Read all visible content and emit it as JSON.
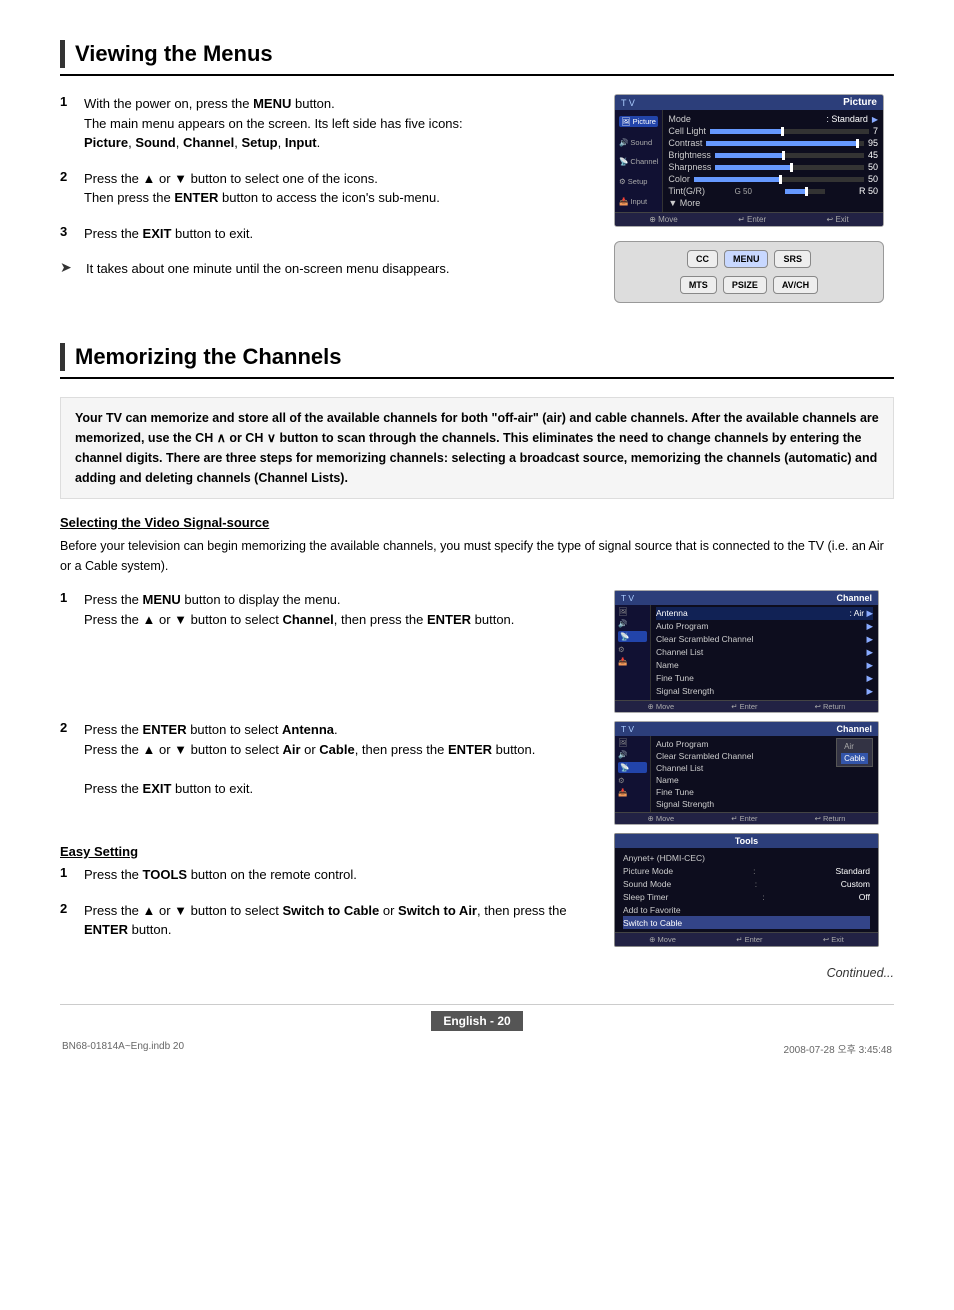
{
  "page": {
    "title": "Viewing the Menus",
    "section2_title": "Memorizing the Channels",
    "footer_text": "English - 20",
    "bottom_left": "BN68-01814A~Eng.indb   20",
    "bottom_right": "2008-07-28   오후 3:45:48",
    "continued": "Continued..."
  },
  "section1": {
    "steps": [
      {
        "num": "1",
        "text": "With the power on, press the MENU button.\nThe main menu appears on the screen. Its left side has five icons:\nPicture, Sound, Channel, Setup, Input."
      },
      {
        "num": "2",
        "text": "Press the ▲ or ▼ button to select one of the icons.\nThen press the ENTER button to access the icon's sub-menu."
      },
      {
        "num": "3",
        "text": "Press the EXIT button to exit."
      }
    ],
    "tip": "It takes about one minute until the on-screen menu disappears.",
    "tv_ui": {
      "header_tv": "T V",
      "header_section": "Picture",
      "sidebar_items": [
        "Picture",
        "Sound",
        "Channel",
        "Setup",
        "Input"
      ],
      "active_sidebar": "Picture",
      "rows": [
        {
          "label": "Mode",
          "value": ": Standard",
          "has_bar": false,
          "has_arrow": true
        },
        {
          "label": "Cell Light",
          "value": "7",
          "has_bar": true,
          "bar_pct": 45,
          "tick": 45
        },
        {
          "label": "Contrast",
          "value": "95",
          "has_bar": true,
          "bar_pct": 95,
          "tick": 95
        },
        {
          "label": "Brightness",
          "value": "45",
          "has_bar": true,
          "bar_pct": 45,
          "tick": 45
        },
        {
          "label": "Sharpness",
          "value": "50",
          "has_bar": true,
          "bar_pct": 50,
          "tick": 50
        },
        {
          "label": "Color",
          "value": "50",
          "has_bar": true,
          "bar_pct": 50,
          "tick": 50
        },
        {
          "label": "Tint(G/R)",
          "value": "G 50",
          "has_bar": true,
          "bar_pct": 50,
          "extra": "R 50"
        },
        {
          "label": "▼ More",
          "value": "",
          "has_bar": false
        }
      ],
      "footer_items": [
        "⊕ Move",
        "↵ Enter",
        "↩ Exit"
      ]
    }
  },
  "section2": {
    "intro": "Your TV can memorize and store all of the available channels for both \"off-air\" (air) and cable channels. After the available channels are memorized, use the CH ∧ or CH ∨ button to scan through the channels. This eliminates the need to change channels by entering the channel digits. There are three steps for memorizing channels: selecting a broadcast source, memorizing the channels (automatic) and adding and deleting channels (Channel Lists).",
    "subsection1_title": "Selecting the Video Signal-source",
    "subsection1_body": "Before your television can begin memorizing the available channels, you must specify the type of signal source that is connected to the TV (i.e. an Air or a Cable system).",
    "steps1": [
      {
        "num": "1",
        "text": "Press the MENU button to display the menu.\nPress the ▲ or ▼ button to select Channel, then press the ENTER button."
      },
      {
        "num": "2",
        "text": "Press the ENTER button to select Antenna.\nPress the ▲ or ▼ button to select Air or Cable, then press the ENTER button.\nPress the EXIT button to exit."
      }
    ],
    "easy_setting_title": "Easy Setting",
    "easy_steps": [
      {
        "num": "1",
        "text": "Press the TOOLS button on the remote control."
      },
      {
        "num": "2",
        "text": "Press the ▲ or ▼ button to select Switch to Cable or Switch to Air, then press the ENTER button."
      }
    ],
    "channel_ui1": {
      "header_tv": "T V",
      "header_section": "Channel",
      "sidebar_items": [
        "Picture",
        "Sound",
        "Channel",
        "Setup",
        "Input"
      ],
      "active_sidebar": "Channel",
      "rows": [
        {
          "label": "Antenna",
          "value": ": Air",
          "arrow": true
        },
        {
          "label": "Auto Program",
          "arrow": true
        },
        {
          "label": "Clear Scrambled Channel",
          "arrow": true
        },
        {
          "label": "Channel List",
          "arrow": true
        },
        {
          "label": "Name",
          "arrow": true
        },
        {
          "label": "Fine Tune",
          "arrow": true
        },
        {
          "label": "Signal Strength",
          "arrow": true
        }
      ],
      "footer_items": [
        "⊕ Move",
        "↵ Enter",
        "↩ Return"
      ]
    },
    "channel_ui2": {
      "header_tv": "T V",
      "header_section": "Channel",
      "sidebar_items": [
        "Picture",
        "Sound",
        "Channel",
        "Setup",
        "Input"
      ],
      "active_sidebar": "Channel",
      "selected_option": "Cable",
      "rows": [
        {
          "label": "Auto Program",
          "options": [
            "Air",
            "Cable"
          ],
          "selected": "Cable"
        },
        {
          "label": "Clear Scrambled Channel"
        },
        {
          "label": "Channel List"
        },
        {
          "label": "Name"
        },
        {
          "label": "Fine Tune"
        },
        {
          "label": "Signal Strength"
        }
      ],
      "footer_items": [
        "⊕ Move",
        "↵ Enter",
        "↩ Return"
      ]
    },
    "tools_ui": {
      "header": "Tools",
      "rows": [
        {
          "label": "Anynet+ (HDMI-CEC)",
          "value": ""
        },
        {
          "label": "Picture Mode",
          "sep": ":",
          "value": "Standard"
        },
        {
          "label": "Sound Mode",
          "sep": ":",
          "value": "Custom"
        },
        {
          "label": "Sleep Timer",
          "sep": ":",
          "value": "Off"
        },
        {
          "label": "Add to Favorite",
          "value": ""
        },
        {
          "label": "Switch to Cable",
          "value": "",
          "highlighted": true
        }
      ],
      "footer_items": [
        "⊕ Move",
        "↵ Enter",
        "↩ Exit"
      ]
    }
  }
}
